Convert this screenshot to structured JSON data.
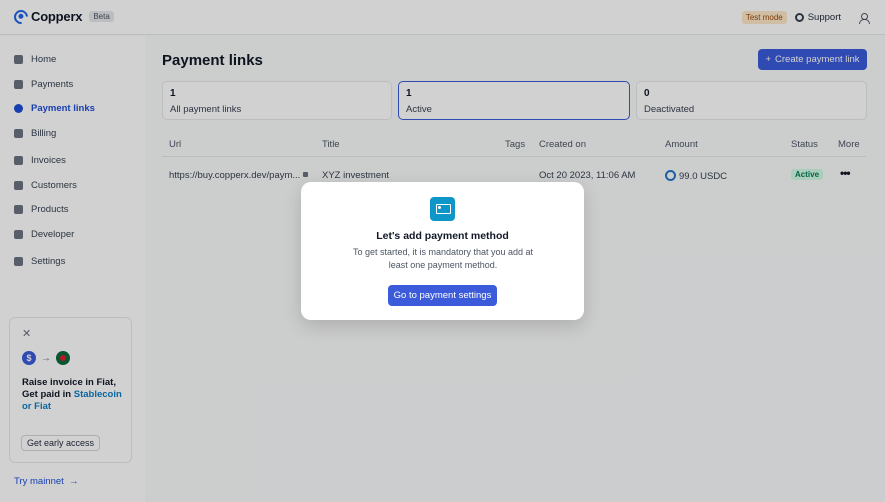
{
  "app": {
    "name": "Copperx",
    "badge": "Beta"
  },
  "topbar": {
    "test_mode": "Test mode",
    "support": "Support"
  },
  "sidebar": {
    "items": [
      {
        "label": "Home",
        "icon": "home-icon"
      },
      {
        "label": "Payments",
        "icon": "payments-icon"
      },
      {
        "label": "Payment links",
        "icon": "link-icon",
        "active": true
      },
      {
        "label": "Billing",
        "icon": "billing-icon"
      },
      {
        "label": "Invoices",
        "icon": "invoice-icon"
      },
      {
        "label": "Customers",
        "icon": "customers-icon"
      },
      {
        "label": "Products",
        "icon": "products-icon"
      },
      {
        "label": "Developer",
        "icon": "developer-icon"
      },
      {
        "label": "Settings",
        "icon": "gear-icon"
      }
    ],
    "promo": {
      "line1": "Raise invoice in Fiat,",
      "line2_prefix": "Get paid in ",
      "line2_highlight": "Stablecoin",
      "line3": "or Fiat",
      "button": "Get early access"
    },
    "mainnet": "Try mainnet"
  },
  "main": {
    "title": "Payment links",
    "create_button": "Create payment link",
    "cards": [
      {
        "count": "1",
        "label": "All payment links"
      },
      {
        "count": "1",
        "label": "Active"
      },
      {
        "count": "0",
        "label": "Deactivated"
      }
    ],
    "table": {
      "headers": [
        "Url",
        "Title",
        "Tags",
        "Created on",
        "Amount",
        "Status",
        "More"
      ],
      "rows": [
        {
          "url": "https://buy.copperx.dev/paym...",
          "title": "XYZ investment",
          "tags": "",
          "created_on": "Oct 20 2023, 11:06 AM",
          "amount": "99.0 USDC",
          "status": "Active"
        }
      ]
    }
  },
  "modal": {
    "title": "Let's add payment method",
    "description": "To get started, it is mandatory that you add at least one payment method.",
    "button": "Go to payment settings"
  },
  "colors": {
    "accent": "#3b5bdb",
    "active_badge_bg": "#d1fae5",
    "active_badge_text": "#047857",
    "test_mode_bg": "#fde7c8"
  }
}
